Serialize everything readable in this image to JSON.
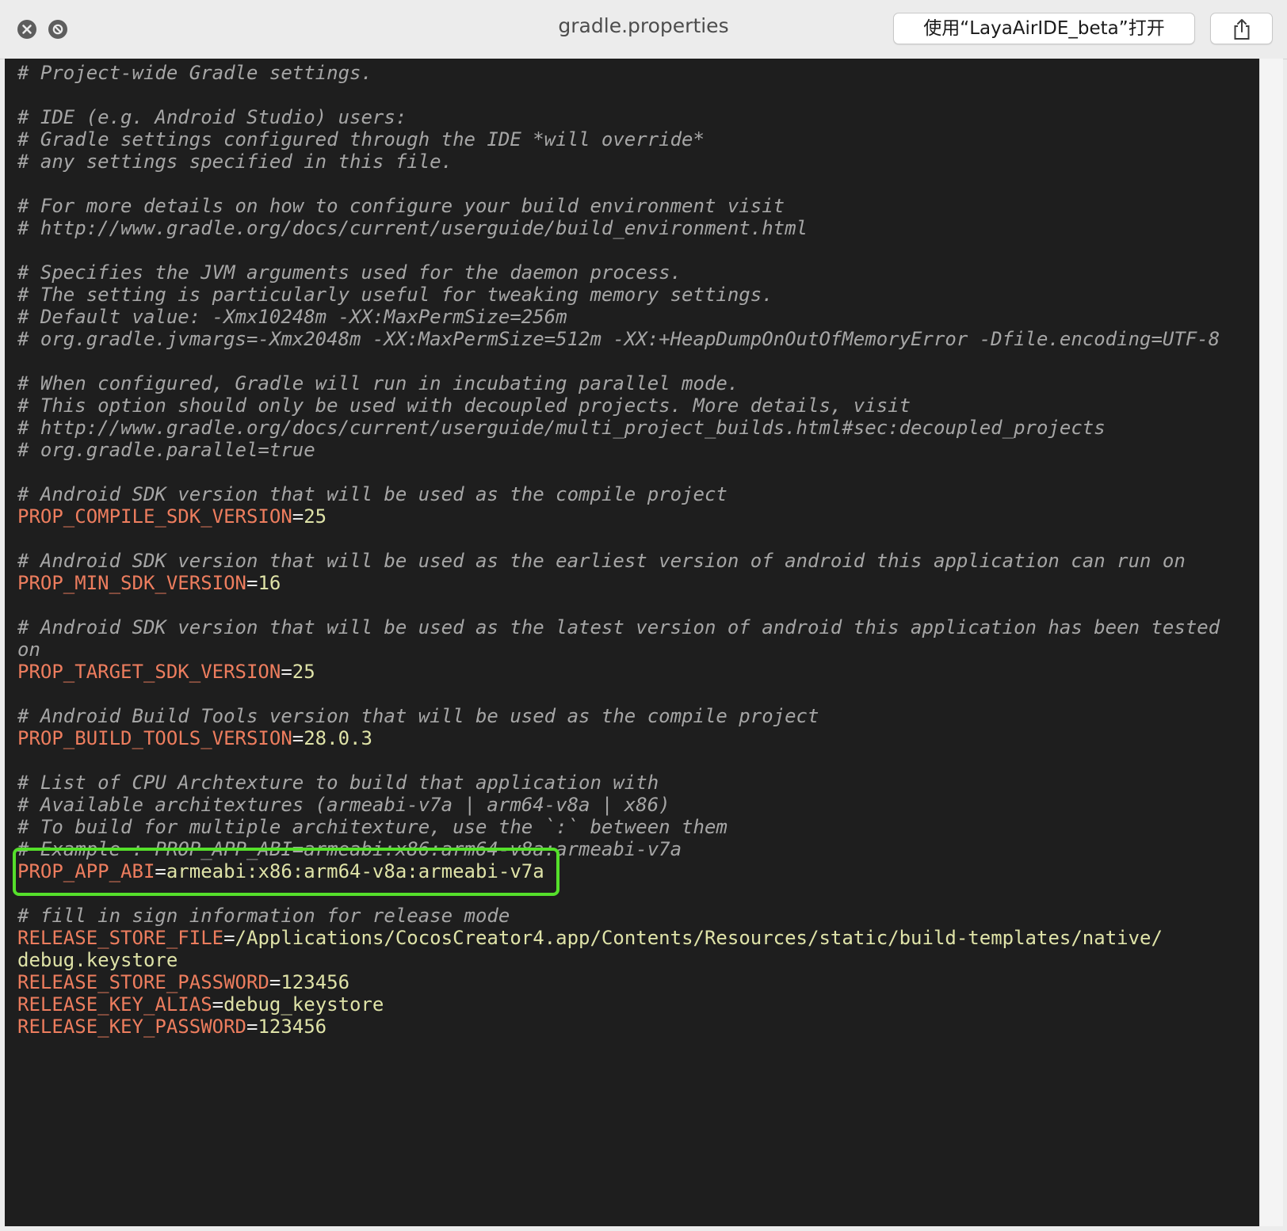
{
  "window": {
    "title": "gradle.properties",
    "open_with_label": "使用“LayaAirIDE_beta”打开",
    "icons": {
      "close": "close-icon",
      "minimize": "minimize-icon",
      "share": "share-icon"
    }
  },
  "colors": {
    "editor_background": "#1e1e1e",
    "comment": "#a6a6a6",
    "property_key": "#ed7d5e",
    "property_value": "#dfe3a8",
    "highlight_box": "#55e02b"
  },
  "file": {
    "lines": [
      {
        "type": "comment",
        "text": "# Project-wide Gradle settings."
      },
      {
        "type": "blank",
        "text": ""
      },
      {
        "type": "comment",
        "text": "# IDE (e.g. Android Studio) users:"
      },
      {
        "type": "comment",
        "text": "# Gradle settings configured through the IDE *will override*"
      },
      {
        "type": "comment",
        "text": "# any settings specified in this file."
      },
      {
        "type": "blank",
        "text": ""
      },
      {
        "type": "comment",
        "text": "# For more details on how to configure your build environment visit"
      },
      {
        "type": "comment",
        "text": "# http://www.gradle.org/docs/current/userguide/build_environment.html"
      },
      {
        "type": "blank",
        "text": ""
      },
      {
        "type": "comment",
        "text": "# Specifies the JVM arguments used for the daemon process."
      },
      {
        "type": "comment",
        "text": "# The setting is particularly useful for tweaking memory settings."
      },
      {
        "type": "comment",
        "text": "# Default value: -Xmx10248m -XX:MaxPermSize=256m"
      },
      {
        "type": "comment",
        "text": "# org.gradle.jvmargs=-Xmx2048m -XX:MaxPermSize=512m -XX:+HeapDumpOnOutOfMemoryError -Dfile.encoding=UTF-8"
      },
      {
        "type": "blank",
        "text": ""
      },
      {
        "type": "comment",
        "text": "# When configured, Gradle will run in incubating parallel mode."
      },
      {
        "type": "comment",
        "text": "# This option should only be used with decoupled projects. More details, visit"
      },
      {
        "type": "comment",
        "text": "# http://www.gradle.org/docs/current/userguide/multi_project_builds.html#sec:decoupled_projects"
      },
      {
        "type": "comment",
        "text": "# org.gradle.parallel=true"
      },
      {
        "type": "blank",
        "text": ""
      },
      {
        "type": "comment",
        "text": "# Android SDK version that will be used as the compile project"
      },
      {
        "type": "prop",
        "key": "PROP_COMPILE_SDK_VERSION",
        "value": "25"
      },
      {
        "type": "blank",
        "text": ""
      },
      {
        "type": "comment",
        "text": "# Android SDK version that will be used as the earliest version of android this application can run on"
      },
      {
        "type": "prop",
        "key": "PROP_MIN_SDK_VERSION",
        "value": "16"
      },
      {
        "type": "blank",
        "text": ""
      },
      {
        "type": "comment",
        "text": "# Android SDK version that will be used as the latest version of android this application has been tested"
      },
      {
        "type": "comment",
        "text": "on"
      },
      {
        "type": "prop",
        "key": "PROP_TARGET_SDK_VERSION",
        "value": "25"
      },
      {
        "type": "blank",
        "text": ""
      },
      {
        "type": "comment",
        "text": "# Android Build Tools version that will be used as the compile project"
      },
      {
        "type": "prop",
        "key": "PROP_BUILD_TOOLS_VERSION",
        "value": "28.0.3"
      },
      {
        "type": "blank",
        "text": ""
      },
      {
        "type": "comment",
        "text": "# List of CPU Archtexture to build that application with"
      },
      {
        "type": "comment",
        "text": "# Available architextures (armeabi-v7a | arm64-v8a | x86)"
      },
      {
        "type": "comment",
        "text": "# To build for multiple architexture, use the `:` between them"
      },
      {
        "type": "comment",
        "text": "# Example : PROP_APP_ABI=armeabi:x86:arm64-v8a:armeabi-v7a"
      },
      {
        "type": "prop",
        "key": "PROP_APP_ABI",
        "value": "armeabi:x86:arm64-v8a:armeabi-v7a",
        "highlighted": true
      },
      {
        "type": "blank",
        "text": ""
      },
      {
        "type": "comment",
        "text": "# fill in sign information for release mode"
      },
      {
        "type": "prop",
        "key": "RELEASE_STORE_FILE",
        "value": "/Applications/CocosCreator4.app/Contents/Resources/static/build-templates/native/"
      },
      {
        "type": "value",
        "text": "debug.keystore"
      },
      {
        "type": "prop",
        "key": "RELEASE_STORE_PASSWORD",
        "value": "123456"
      },
      {
        "type": "prop",
        "key": "RELEASE_KEY_ALIAS",
        "value": "debug_keystore"
      },
      {
        "type": "prop",
        "key": "RELEASE_KEY_PASSWORD",
        "value": "123456"
      }
    ]
  }
}
